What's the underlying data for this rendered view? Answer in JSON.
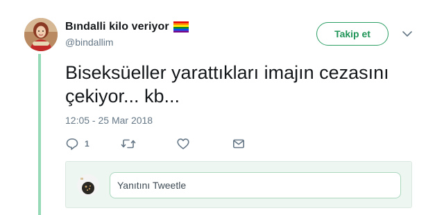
{
  "tweet": {
    "author": {
      "display_name": "Bındalli kilo veriyor",
      "handle": "@bindallim",
      "flag_icon": "rainbow-flag-icon"
    },
    "text_line1": "Biseksüeller yarattıkları imajın cezasını",
    "text_line2": "çekiyor... kb...",
    "timestamp": "12:05 - 25 Mar 2018",
    "follow_label": "Takip et",
    "actions": {
      "reply_icon": "reply-icon",
      "reply_count": "1",
      "retweet_icon": "retweet-icon",
      "like_icon": "heart-icon",
      "message_icon": "envelope-icon"
    }
  },
  "reply": {
    "placeholder": "Yanıtını Tweetle"
  },
  "colors": {
    "accent": "#1f9457",
    "thread_line": "#95d9b6",
    "muted_text": "#657786",
    "reply_bg": "#edf6f1"
  }
}
